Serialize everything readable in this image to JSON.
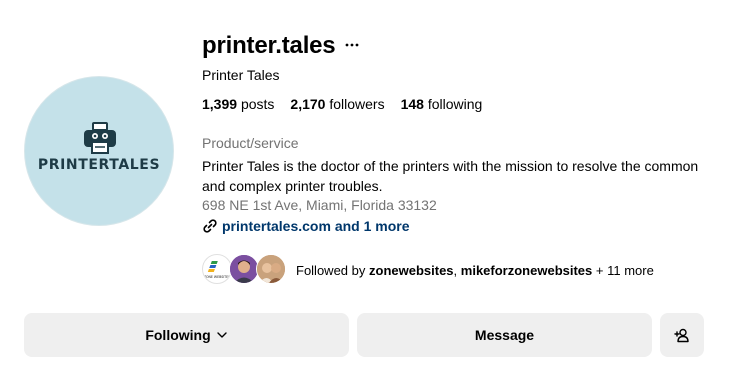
{
  "profile": {
    "username": "printer.tales",
    "more_icon": "ellipsis-icon",
    "full_name": "Printer Tales",
    "stats": {
      "posts_count": "1,399",
      "posts_label": "posts",
      "followers_count": "2,170",
      "followers_label": "followers",
      "following_count": "148",
      "following_label": "following"
    },
    "category": "Product/service",
    "bio": "Printer Tales is the doctor of the printers with the mission to resolve the common and complex printer troubles.",
    "address": "698 NE 1st Ave, Miami, Florida 33132",
    "website": {
      "icon": "link-icon",
      "text": "printertales.com and 1 more"
    },
    "avatar": {
      "wordmark": "PRINTERTALES",
      "background": "#c4e1e9"
    },
    "followed_by": {
      "prefix": "Followed by",
      "names": [
        "zonewebsites",
        "mikeforzonewebsites"
      ],
      "separator": ",",
      "suffix": "+ 11 more",
      "mini_avatar_1_text": "ZONE WEBSITES"
    }
  },
  "actions": {
    "following_label": "Following",
    "following_icon": "chevron-down-icon",
    "message_label": "Message",
    "suggest_icon": "add-person-icon"
  },
  "colors": {
    "secondary_text": "#737373",
    "link": "#00376b",
    "button_bg": "#efefef"
  }
}
